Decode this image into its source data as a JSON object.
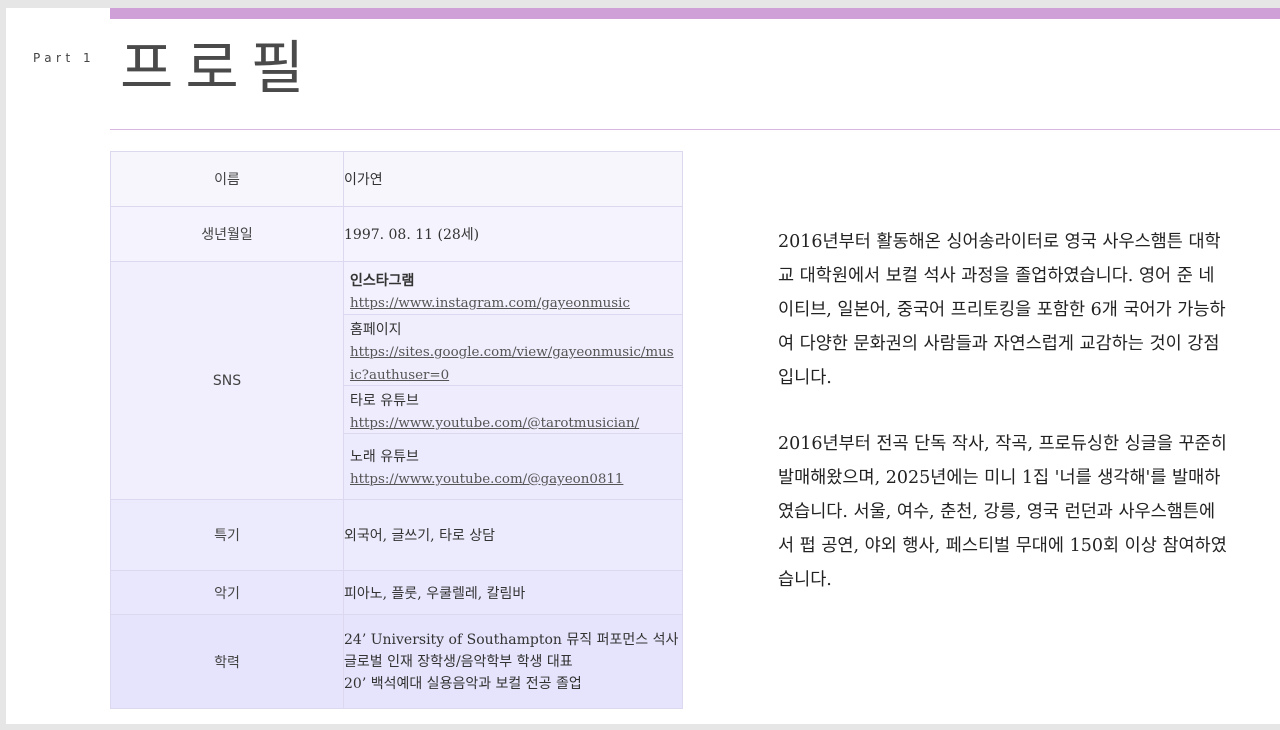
{
  "header": {
    "part_label": "Part 1",
    "title": "프로필"
  },
  "profile": {
    "name": {
      "label": "이름",
      "value": "이가연"
    },
    "birth": {
      "label": "생년월일",
      "value": "1997. 08. 11 (28세)"
    },
    "sns": {
      "label": "SNS",
      "items": [
        {
          "label": "인스타그램",
          "url": "https://www.instagram.com/gayeonmusic"
        },
        {
          "label": "홈페이지",
          "url": "https://sites.google.com/view/gayeonmusic/music?authuser=0"
        },
        {
          "label": "타로 유튜브",
          "url": "https://www.youtube.com/@tarotmusician/"
        },
        {
          "label": "노래 유튜브",
          "url": "https://www.youtube.com/@gayeon0811"
        }
      ]
    },
    "skills": {
      "label": "특기",
      "value": "외국어, 글쓰기, 타로 상담"
    },
    "instruments": {
      "label": "악기",
      "value": "피아노, 플룻, 우쿨렐레, 칼림바"
    },
    "education": {
      "label": "학력",
      "lines": [
        "24’ University of Southampton 뮤직 퍼포먼스 석사",
        "글로벌 인재 장학생/음악학부 학생 대표",
        "20’ 백석예대 실용음악과 보컬 전공 졸업"
      ]
    }
  },
  "bio": {
    "paragraph_1": "2016년부터 활동해온 싱어송라이터로 영국 사우스햄튼 대학교 대학원에서 보컬 석사 과정을 졸업하였습니다. 영어 준 네이티브, 일본어, 중국어 프리토킹을 포함한 6개 국어가 가능하여 다양한 문화권의 사람들과 자연스럽게 교감하는 것이 강점입니다.",
    "paragraph_2": "2016년부터 전곡 단독 작사, 작곡, 프로듀싱한 싱글을 꾸준히 발매해왔으며, 2025년에는 미니 1집 '너를 생각해'를 발매하였습니다. 서울, 여수, 춘천, 강릉, 영국 런던과 사우스햄튼에서 펍 공연, 야외 행사, 페스티벌 무대에 150회 이상 참여하였습니다."
  },
  "colors": {
    "accent_bar": "#cfa0d8",
    "divider": "#d8b6df",
    "table_border": "#dcd8f0",
    "table_fill": "#ecebfd"
  }
}
